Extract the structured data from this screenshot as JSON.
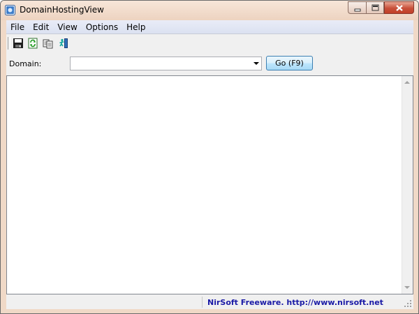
{
  "window": {
    "title": "DomainHostingView",
    "icon": "app-icon",
    "caption_buttons": [
      "minimize-icon",
      "maximize-icon",
      "close-icon"
    ]
  },
  "menu": {
    "items": [
      {
        "label": "File"
      },
      {
        "label": "Edit"
      },
      {
        "label": "View"
      },
      {
        "label": "Options"
      },
      {
        "label": "Help"
      }
    ]
  },
  "toolbar": {
    "buttons": [
      {
        "icon": "save-icon"
      },
      {
        "icon": "refresh-icon"
      },
      {
        "icon": "copy-icon"
      },
      {
        "icon": "exit-icon"
      }
    ]
  },
  "form": {
    "domain_label": "Domain:",
    "domain_value": "",
    "go_label": "Go  (F9)"
  },
  "results": {
    "rows": []
  },
  "status": {
    "left_text": "",
    "link_text": "NirSoft Freeware.  http://www.nirsoft.net"
  },
  "colors": {
    "titlebar": "#f0d9c7",
    "close_button": "#c8503a",
    "status_link": "#1a1aa6"
  }
}
